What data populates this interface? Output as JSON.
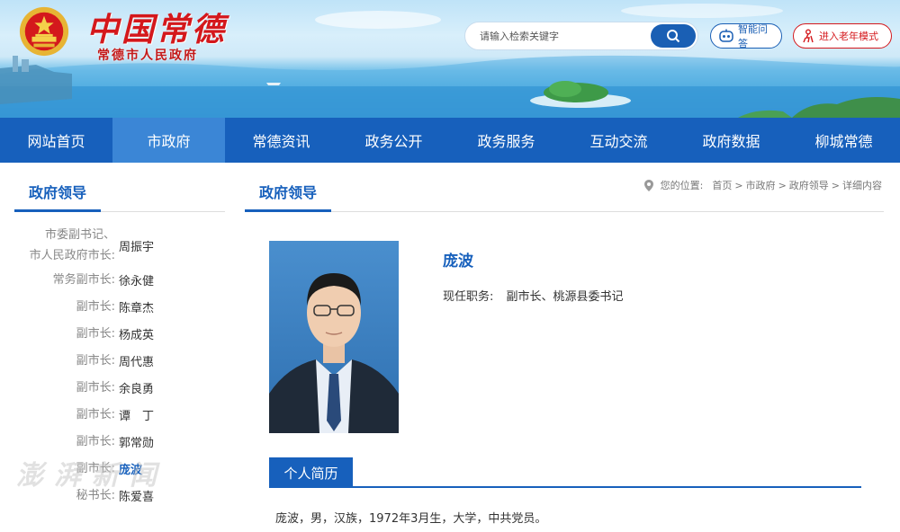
{
  "header": {
    "site_title": "中国常德",
    "site_subtitle": "常德市人民政府",
    "search_placeholder": "请输入检索关键字",
    "ai_label": "智能问答",
    "elder_label": "进入老年模式"
  },
  "nav": [
    "网站首页",
    "市政府",
    "常德资讯",
    "政务公开",
    "政务服务",
    "互动交流",
    "政府数据",
    "柳城常德"
  ],
  "nav_active": "市政府",
  "sidebar": {
    "title": "政府领导",
    "leaders": [
      {
        "role_line1": "市委副书记、",
        "role_line2": "市人民政府市长:",
        "name": "周振宇"
      },
      {
        "role": "常务副市长:",
        "name": "徐永健"
      },
      {
        "role": "副市长:",
        "name": "陈章杰"
      },
      {
        "role": "副市长:",
        "name": "杨成英"
      },
      {
        "role": "副市长:",
        "name": "周代惠"
      },
      {
        "role": "副市长:",
        "name": "余良勇"
      },
      {
        "role": "副市长:",
        "name": "谭　丁"
      },
      {
        "role": "副市长:",
        "name": "郭常勋"
      },
      {
        "role": "副市长:",
        "name": "庞波"
      },
      {
        "role": "秘书长:",
        "name": "陈爱喜"
      }
    ],
    "watermark": "澎湃新闻"
  },
  "main": {
    "title": "政府领导",
    "breadcrumb": {
      "label": "您的位置:",
      "items": [
        "首页",
        "市政府",
        "政府领导",
        "详细内容"
      ],
      "separator": ">"
    },
    "person_name": "庞波",
    "position_label": "现任职务:",
    "position_value": "副市长、桃源县委书记",
    "bio_tab": "个人简历",
    "bio_text": "庞波，男，汉族，1972年3月生，大学，中共党员。"
  },
  "colors": {
    "primary": "#1760bc",
    "nav_active": "#3b86d6",
    "brand_red": "#d4181c"
  }
}
